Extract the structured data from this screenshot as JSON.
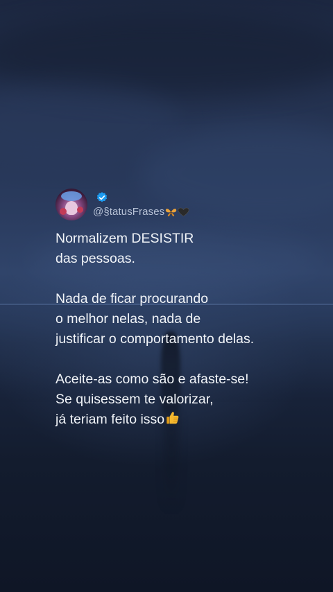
{
  "background": {
    "description_colors": {
      "sky": "#2a3b5e",
      "sea": "#18233a",
      "dark": "#0f1626"
    }
  },
  "post": {
    "handle": "@§tatusFrases",
    "verified_icon": "verified-badge-icon",
    "handle_emojis": [
      "butterfly-icon",
      "black-heart-icon"
    ],
    "paragraphs": [
      [
        "Normalizem DESISTIR",
        "das pessoas."
      ],
      [
        "Nada de ficar procurando",
        "o melhor nelas, nada de",
        "justificar o comportamento delas."
      ],
      [
        "Aceite-as como são e afaste-se!",
        "Se quisessem te valorizar,",
        "já teriam feito isso"
      ]
    ],
    "end_emoji": "thumbs-up-icon"
  },
  "colors": {
    "text": "#f1f4f8",
    "handle": "#b7c2d6",
    "verified": "#1d9bf0"
  }
}
